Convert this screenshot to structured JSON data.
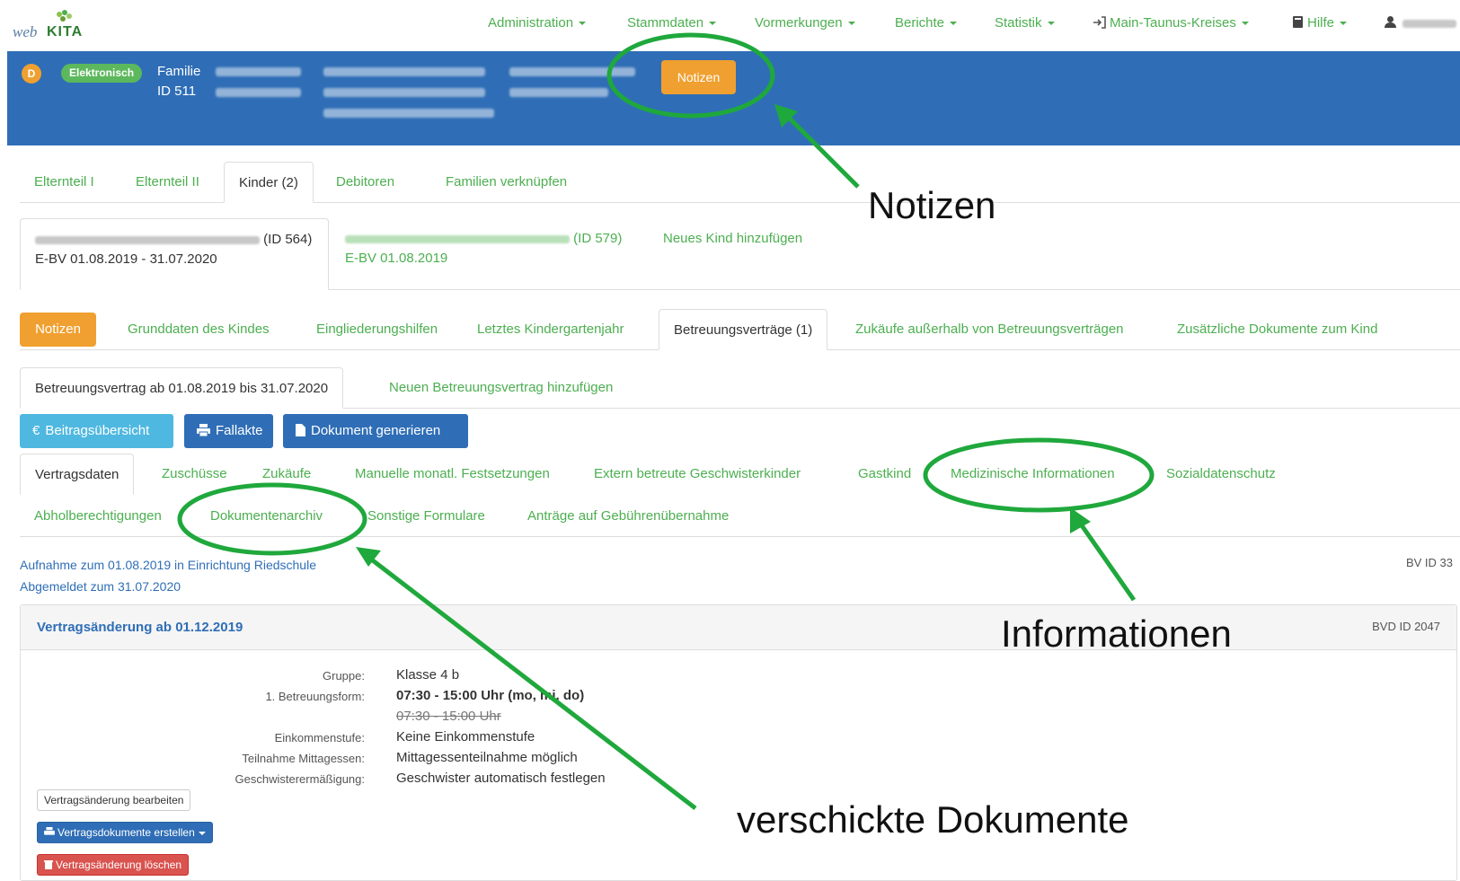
{
  "app": {
    "logo_web": "web",
    "logo_kita": "KITA"
  },
  "nav": {
    "items": [
      {
        "label": "Administration",
        "icon": null
      },
      {
        "label": "Stammdaten",
        "icon": null
      },
      {
        "label": "Vormerkungen",
        "icon": null
      },
      {
        "label": "Berichte",
        "icon": null
      },
      {
        "label": "Statistik",
        "icon": null
      },
      {
        "label": "Main-Taunus-Kreises",
        "icon": "sign-in-icon"
      },
      {
        "label": "Hilfe",
        "icon": "book-icon"
      }
    ],
    "user_icon": "user-icon"
  },
  "family": {
    "badge_d": "D",
    "badge_type": "Elektronisch",
    "label": "Familie",
    "id_label": "ID 511",
    "notes_button": "Notizen"
  },
  "family_tabs": [
    "Elternteil I",
    "Elternteil II",
    "Kinder (2)",
    "Debitoren",
    "Familien verknüpfen"
  ],
  "family_tabs_active": "Kinder (2)",
  "children": [
    {
      "id_label": "(ID 564)",
      "contract": "E-BV 01.08.2019 - 31.07.2020"
    },
    {
      "id_label": "(ID 579)",
      "contract": "E-BV 01.08.2019"
    }
  ],
  "add_child": "Neues Kind hinzufügen",
  "child_notes_button": "Notizen",
  "child_tabs": [
    "Grunddaten des Kindes",
    "Eingliederungshilfen",
    "Letztes Kindergartenjahr",
    "Betreuungsverträge (1)",
    "Zukäufe außerhalb von Betreuungsverträgen",
    "Zusätzliche Dokumente zum Kind"
  ],
  "child_tabs_active": "Betreuungsverträge (1)",
  "contract_tabs": [
    "Betreuungsvertrag ab 01.08.2019 bis 31.07.2020",
    "Neuen Betreuungsvertrag hinzufügen"
  ],
  "action_buttons": {
    "fees": "Beitragsübersicht",
    "fees_icon": "euro-icon",
    "case_file": "Fallakte",
    "case_file_icon": "print-icon",
    "generate_doc": "Dokument generieren",
    "generate_doc_icon": "file-icon"
  },
  "detail_tabs_row1": [
    "Vertragsdaten",
    "Zuschüsse",
    "Zukäufe",
    "Manuelle monatl. Festsetzungen",
    "Extern betreute Geschwisterkinder",
    "Gastkind",
    "Medizinische Informationen",
    "Sozialdatenschutz"
  ],
  "detail_tabs_row2": [
    "Abholberechtigungen",
    "Dokumentenarchiv",
    "Sonstige Formulare",
    "Anträge auf Gebührenübernahme"
  ],
  "detail_tabs_active": "Vertragsdaten",
  "admission": {
    "line1": "Aufnahme zum 01.08.2019 in Einrichtung Riedschule",
    "line2": "Abgemeldet zum 31.07.2020",
    "bv_id": "BV ID 33"
  },
  "change_panel": {
    "title": "Vertragsänderung ab 01.12.2019",
    "id": "BVD ID 2047",
    "fields": [
      {
        "label": "Gruppe:",
        "value": "Klasse 4 b",
        "style": "normal"
      },
      {
        "label": "1. Betreuungsform:",
        "value": "07:30 - 15:00 Uhr (mo, mi, do)",
        "style": "bold"
      },
      {
        "label": "",
        "value": "07:30 - 15:00 Uhr",
        "style": "strike"
      },
      {
        "label": "Einkommenstufe:",
        "value": "Keine Einkommenstufe",
        "style": "normal"
      },
      {
        "label": "Teilnahme Mittagessen:",
        "value": "Mittagessenteilnahme möglich",
        "style": "normal"
      },
      {
        "label": "Geschwisterermäßigung:",
        "value": "Geschwister automatisch festlegen",
        "style": "normal"
      }
    ],
    "edit_button": "Vertragsänderung bearbeiten",
    "create_docs_button": "Vertragsdokumente erstellen",
    "delete_button": "Vertragsänderung löschen"
  },
  "annotations": {
    "notizen": "Notizen",
    "informationen": "Informationen",
    "dokumente": "verschickte Dokumente",
    "color": "#1fa83c"
  },
  "colors": {
    "primary_blue": "#2f6eb6",
    "link_green": "#4caf50",
    "orange": "#f0a030",
    "cyan": "#4fb8e0",
    "danger": "#d9534f"
  }
}
